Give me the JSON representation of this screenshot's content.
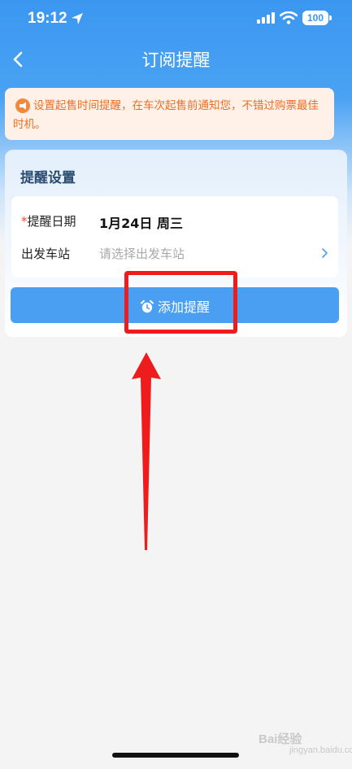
{
  "status_bar": {
    "time": "19:12",
    "battery": "100"
  },
  "nav": {
    "title": "订阅提醒"
  },
  "notice": {
    "text": "设置起售时间提醒，在车次起售前通知您，不错过购票最佳时机。"
  },
  "settings": {
    "title": "提醒设置",
    "date_required_mark": "*",
    "date_label": "提醒日期",
    "date_value": "1月24日 周三",
    "station_label": "出发车站",
    "station_placeholder": "请选择出发车站"
  },
  "add_button": {
    "label": "添加提醒"
  },
  "watermark": {
    "text": "Bai经验",
    "sub": "jingyan.baidu.com"
  },
  "colors": {
    "primary": "#4a9ff2",
    "notice_text": "#ee6e26",
    "annotation": "#ee1c1c"
  }
}
